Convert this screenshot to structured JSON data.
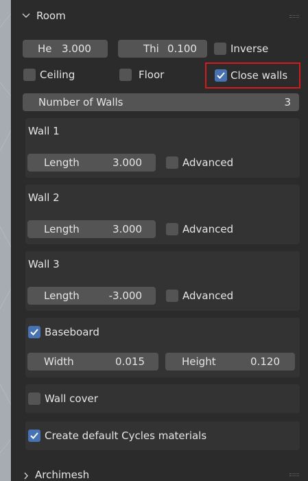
{
  "panel": {
    "title": "Room",
    "collapsed_panel_title": "Archimesh"
  },
  "top": {
    "height_label": "He",
    "height_value": "3.000",
    "thickness_label": "Thi",
    "thickness_value": "0.100",
    "inverse_label": "Inverse",
    "inverse_checked": false,
    "ceiling_label": "Ceiling",
    "ceiling_checked": false,
    "floor_label": "Floor",
    "floor_checked": false,
    "close_walls_label": "Close walls",
    "close_walls_checked": true,
    "number_of_walls_label": "Number of Walls",
    "number_of_walls_value": "3"
  },
  "walls": [
    {
      "title": "Wall 1",
      "length_label": "Length",
      "length_value": "3.000",
      "advanced_label": "Advanced",
      "advanced_checked": false
    },
    {
      "title": "Wall 2",
      "length_label": "Length",
      "length_value": "3.000",
      "advanced_label": "Advanced",
      "advanced_checked": false
    },
    {
      "title": "Wall 3",
      "length_label": "Length",
      "length_value": "-3.000",
      "advanced_label": "Advanced",
      "advanced_checked": false
    }
  ],
  "baseboard": {
    "label": "Baseboard",
    "checked": true,
    "width_label": "Width",
    "width_value": "0.015",
    "height_label": "Height",
    "height_value": "0.120"
  },
  "wall_cover": {
    "label": "Wall cover",
    "checked": false
  },
  "materials": {
    "label": "Create default Cycles materials",
    "checked": true
  },
  "colors": {
    "panel_bg": "#2b2b2b",
    "box_bg": "#333333",
    "field_bg": "#545454",
    "checkbox_on": "#4772b3",
    "highlight": "#d21c1c"
  }
}
